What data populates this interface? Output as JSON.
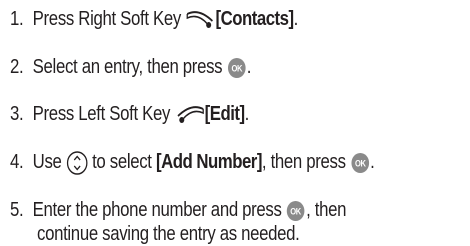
{
  "steps": [
    {
      "number": "1.",
      "before": "Press Right Soft Key",
      "icon": "right-soft-key-icon",
      "bold": "[Contacts]",
      "after": "."
    },
    {
      "number": "2.",
      "before": "Select an entry, then press",
      "icon": "ok-key-icon",
      "after": "."
    },
    {
      "number": "3.",
      "before": "Press Left Soft Key",
      "icon": "left-soft-key-icon",
      "bold": "[Edit]",
      "after": "."
    },
    {
      "number": "4.",
      "before": "Use",
      "icon": "navigation-key-icon",
      "middle": "to select",
      "bold": "[Add Number]",
      "middle2": ", then press",
      "icon2": "ok-key-icon",
      "after": "."
    },
    {
      "number": "5.",
      "before": "Enter the phone number and press",
      "icon": "ok-key-icon",
      "after": ", then",
      "continuation": "continue saving the entry as needed."
    }
  ],
  "colors": {
    "text": "#231f20",
    "ok_key_fill": "#8a8a8a",
    "icon_stroke": "#231f20"
  }
}
